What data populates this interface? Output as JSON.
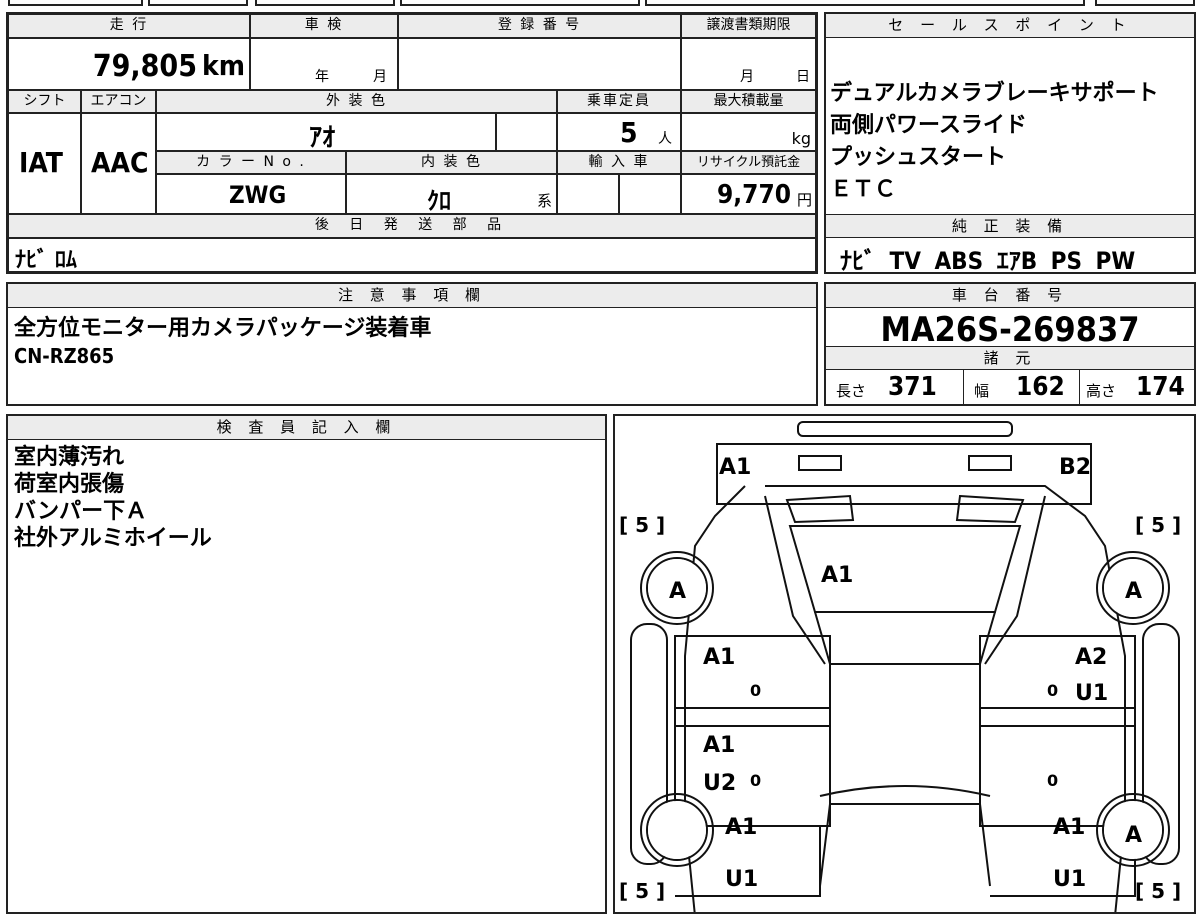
{
  "labels": {
    "mileage": "走 行",
    "inspection": "車 検",
    "registration": "登 録 番 号",
    "transfer_deadline": "譲渡書類期限",
    "shift": "シフト",
    "aircon": "エアコン",
    "exterior_color": "外 装 色",
    "capacity": "乗車定員",
    "max_load": "最大積載量",
    "color_no": "カ ラ ー N o .",
    "interior_color": "内 装 色",
    "import": "輸 入 車",
    "recycle": "リサイクル預託金",
    "later_parts": "後 日 発 送 部 品",
    "sales_points": "セ ー ル ス ポ イ ン ト",
    "genuine_equipment": "純 正 装 備",
    "notes": "注 意 事 項 欄",
    "chassis_no": "車 台 番 号",
    "specs": "諸 元",
    "inspector": "検 査 員 記 入 欄"
  },
  "vehicle": {
    "mileage_value": "79,805",
    "mileage_unit": "km",
    "inspection_year_unit": "年",
    "inspection_month_unit": "月",
    "transfer_month_unit": "月",
    "transfer_day_unit": "日",
    "shift_value": "IAT",
    "aircon_value": "AAC",
    "exterior_color_value": "ｱｵ",
    "capacity_value": "5",
    "capacity_unit": "人",
    "max_load_unit": "kg",
    "color_no_value": "ZWG",
    "interior_color_value": "ｸﾛ",
    "interior_color_suffix": "系",
    "recycle_value": "9,770",
    "recycle_unit": "円",
    "later_parts_value": "ﾅﾋﾞ ﾛﾑ"
  },
  "sales_points": [
    "デュアルカメラブレーキサポート",
    "両側パワースライド",
    "プッシュスタート",
    "ＥＴＣ"
  ],
  "genuine_equipment": "ﾅﾋﾞ TV ABS ｴｱB PS PW",
  "notes": [
    "全方位モニター用カメラパッケージ装着車",
    "CN-RZ865"
  ],
  "chassis_no_value": "MA26S-269837",
  "specs": {
    "length_label": "長さ",
    "length_value": "371",
    "width_label": "幅",
    "width_value": "162",
    "height_label": "高さ",
    "height_value": "174"
  },
  "inspector_notes": [
    "室内薄汚れ",
    "荷室内張傷",
    "バンパー下Ａ",
    "社外アルミホイール"
  ],
  "diagram": {
    "marks": {
      "front_left": "A1",
      "front_right": "B2",
      "hood": "A1",
      "wheel_fl": "A",
      "wheel_fr": "A",
      "wheel_rr": "A",
      "door_fl": "A1",
      "door_fr_1": "A2",
      "door_fr_2": "U1",
      "door_rl_1": "A1",
      "door_rl_2": "U2",
      "quarter_l": "A1",
      "quarter_r": "A1",
      "rear_l": "U1",
      "rear_r": "U1",
      "zero": "0",
      "tire_depth": "[ 5 ]"
    }
  }
}
